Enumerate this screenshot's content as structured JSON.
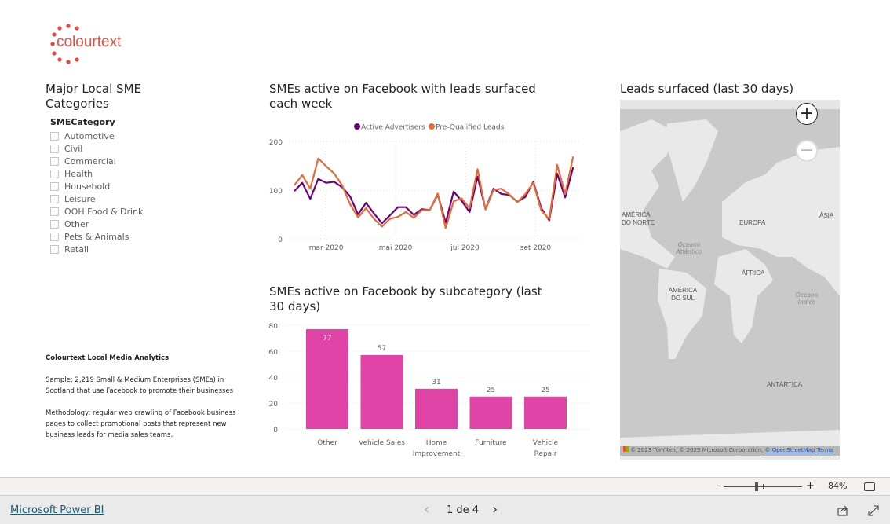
{
  "brand": {
    "logo_text": "colourtext",
    "color": "#f0483e"
  },
  "slicer": {
    "title": "Major Local SME Categories",
    "field": "SMECategory",
    "items": [
      "Automotive",
      "Civil",
      "Commercial",
      "Health",
      "Household",
      "Leisure",
      "OOH Food & Drink",
      "Other",
      "Pets & Animals",
      "Retail"
    ]
  },
  "info": {
    "heading": "Colourtext Local Media Analytics",
    "sample": "Sample: 2,219 Small & Medium Enterprises (SMEs) in Scotland that use Facebook to promote their businesses",
    "methodology": "Methodology: regular web crawling of Facebook business pages to collect promotional posts that represent new business leads for media sales teams."
  },
  "chart_data": [
    {
      "type": "line",
      "title": "SMEs active on Facebook with leads surfaced each week",
      "x_start": "2020-02-02",
      "x_interval": "weekly",
      "x_ticks": [
        {
          "date": "2020-03-01",
          "label": "mar 2020"
        },
        {
          "date": "2020-05-01",
          "label": "mai 2020"
        },
        {
          "date": "2020-07-01",
          "label": "jul 2020"
        },
        {
          "date": "2020-09-01",
          "label": "set 2020"
        }
      ],
      "y_ticks": [
        0,
        100,
        200
      ],
      "ylim": [
        0,
        200
      ],
      "grid": true,
      "legend": "top-center",
      "series": [
        {
          "name": "Active Advertisers",
          "color": "#6b007b",
          "values": [
            98,
            115,
            82,
            123,
            115,
            117,
            106,
            87,
            50,
            74,
            52,
            32,
            48,
            65,
            65,
            49,
            61,
            59,
            91,
            33,
            97,
            78,
            55,
            128,
            61,
            103,
            92,
            90,
            76,
            86,
            117,
            63,
            38,
            134,
            85,
            147
          ]
        },
        {
          "name": "Pre-Qualified Leads",
          "color": "#e66c37",
          "values": [
            110,
            131,
            103,
            165,
            149,
            134,
            110,
            71,
            44,
            63,
            41,
            25,
            41,
            45,
            55,
            43,
            59,
            59,
            93,
            22,
            77,
            83,
            63,
            143,
            60,
            100,
            103,
            91,
            75,
            92,
            115,
            58,
            41,
            152,
            92,
            169
          ]
        }
      ]
    },
    {
      "type": "bar",
      "title": "SMEs active on Facebook by subcategory (last 30 days)",
      "categories": [
        "Other",
        "Vehicle Sales",
        "Home Improvement",
        "Furniture",
        "Vehicle Repair"
      ],
      "values": [
        77,
        57,
        31,
        25,
        25
      ],
      "color": "#e044a7",
      "y_ticks": [
        0,
        20,
        40,
        60,
        80
      ],
      "ylim": [
        0,
        80
      ],
      "grid": true
    }
  ],
  "map": {
    "title": "Leads surfaced (last 30 days)",
    "labels": {
      "na": "AMÉRICA DO NORTE",
      "eu": "EUROPA",
      "asia": "ÁSIA",
      "af": "ÁFRICA",
      "sa": "AMÉRICA DO SUL",
      "ant": "ANTÁRTICA",
      "atl": "Oceano Atlântico",
      "ind": "Oceano Índico"
    },
    "attribution": "© 2023 TomTom, © 2023 Microsoft Corporation,",
    "osm_link": "© OpenStreetMap",
    "terms_link": "Terms",
    "zoom_in": "+",
    "zoom_out": "−"
  },
  "footer": {
    "zoom_minus": "-",
    "zoom_plus": "+",
    "zoom_level": "84%",
    "zoom_percent": 84,
    "product_link": "Microsoft Power BI",
    "page_indicator": "1 de 4",
    "prev": "‹",
    "next": "›"
  }
}
